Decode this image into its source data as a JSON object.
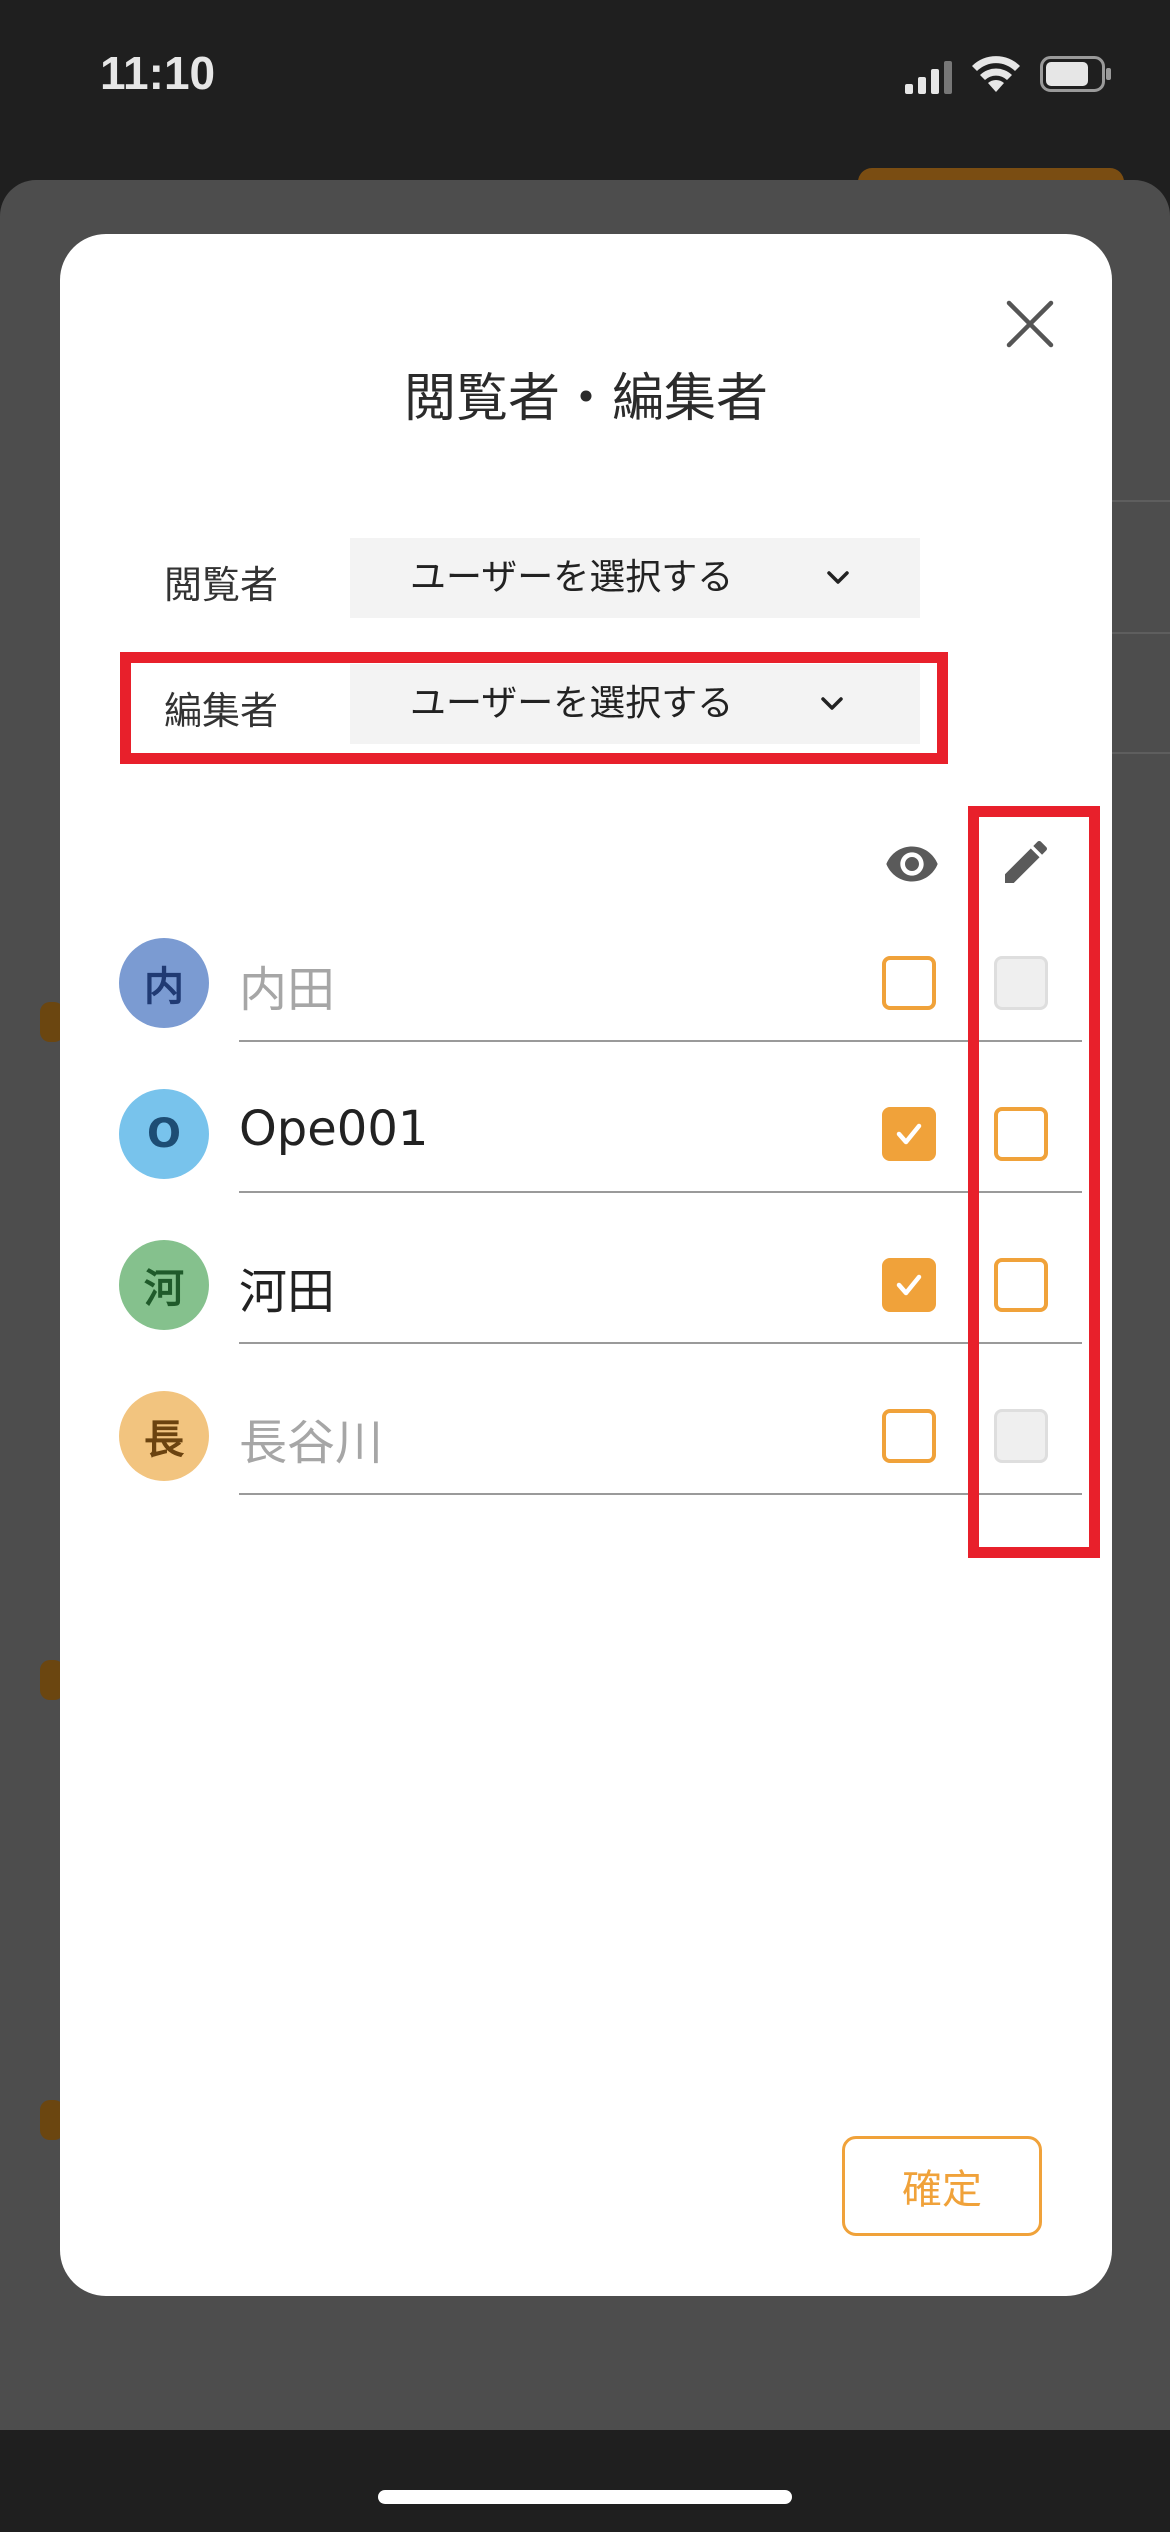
{
  "status_bar": {
    "time": "11:10"
  },
  "modal": {
    "title": "閲覧者・編集者",
    "viewer_field": {
      "label": "閲覧者",
      "value": "ユーザーを選択する"
    },
    "editor_field": {
      "label": "編集者",
      "value": "ユーザーを選択する"
    },
    "column_icons": {
      "viewer": "eye-icon",
      "editor": "pencil-icon"
    },
    "users": [
      {
        "initial": "内",
        "name": "内田",
        "avatar_color": "#7b9bd2",
        "initial_color": "#203a73",
        "viewer_checked": false,
        "editor_checked": false,
        "editor_enabled": false,
        "name_active": false
      },
      {
        "initial": "O",
        "name": "Ope001",
        "avatar_color": "#78c3ec",
        "initial_color": "#1d4d74",
        "viewer_checked": true,
        "editor_checked": false,
        "editor_enabled": true,
        "name_active": true
      },
      {
        "initial": "河",
        "name": "河田",
        "avatar_color": "#85c18d",
        "initial_color": "#1f5a2a",
        "viewer_checked": true,
        "editor_checked": false,
        "editor_enabled": true,
        "name_active": true
      },
      {
        "initial": "長",
        "name": "長谷川",
        "avatar_color": "#f2c47f",
        "initial_color": "#6b4310",
        "viewer_checked": false,
        "editor_checked": false,
        "editor_enabled": false,
        "name_active": false
      }
    ],
    "confirm_label": "確定"
  },
  "colors": {
    "accent": "#f0a23a",
    "highlight": "#e8202b",
    "overlay": "#4d4d4d"
  }
}
